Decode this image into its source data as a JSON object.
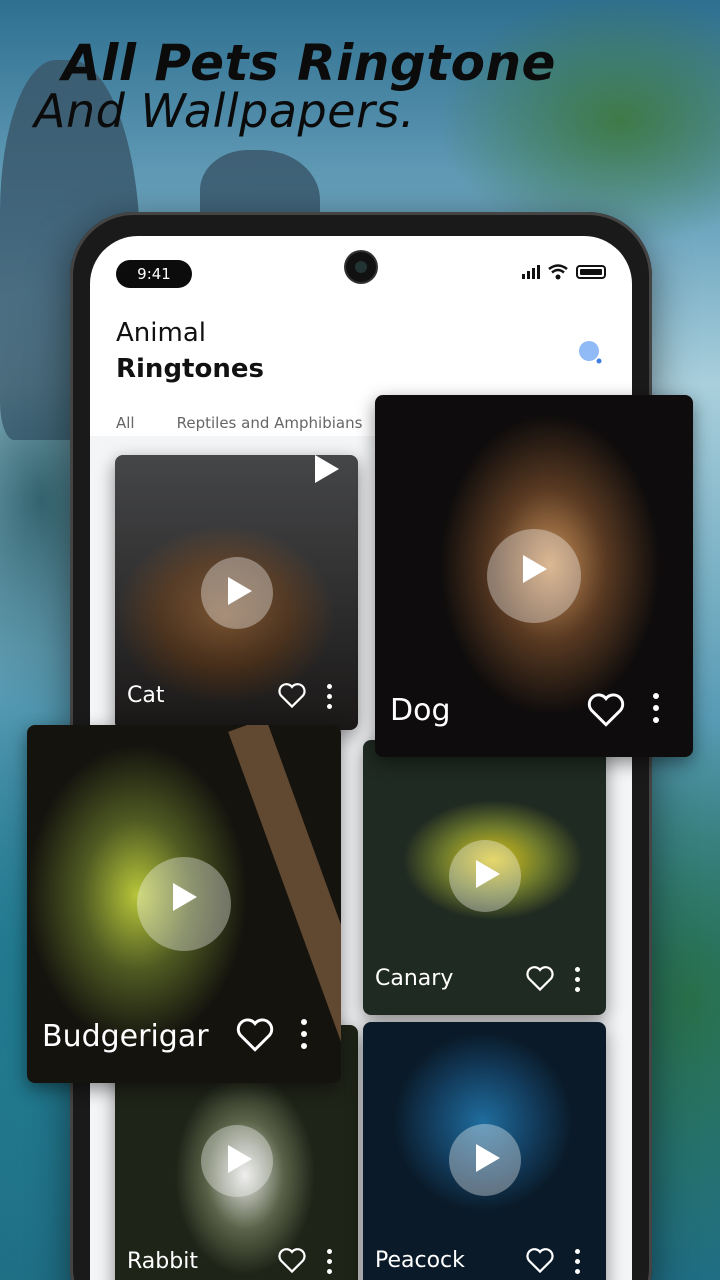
{
  "headline": {
    "line1": "All Pets Ringtone",
    "line2": "And Wallpapers."
  },
  "status_bar": {
    "time": "9:41"
  },
  "header": {
    "title_top": "Animal",
    "title_bottom": "Ringtones"
  },
  "tabs": [
    {
      "label": "All"
    },
    {
      "label": "Reptiles and Amphibians"
    }
  ],
  "cards": {
    "cat": {
      "name": "Cat"
    },
    "dog": {
      "name": "Dog"
    },
    "budgerigar": {
      "name": "Budgerigar"
    },
    "canary": {
      "name": "Canary"
    },
    "rabbit": {
      "name": "Rabbit"
    },
    "peacock": {
      "name": "Peacock"
    }
  },
  "icons": {
    "search": "search-icon",
    "heart": "heart-outline-icon",
    "more": "more-vert-icon",
    "play": "play-icon"
  },
  "colors": {
    "accent": "#5a9cf0",
    "card_text": "#ffffff",
    "screen_bg": "#ffffff"
  }
}
